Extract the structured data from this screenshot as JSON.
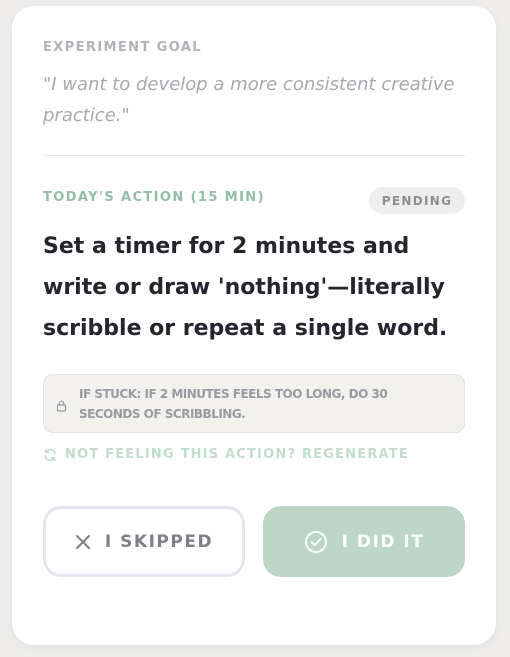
{
  "goal": {
    "label": "EXPERIMENT GOAL",
    "quote": "\"I want to develop a more consistent creative practice.\""
  },
  "action": {
    "label": "TODAY'S ACTION (15 MIN)",
    "status": "PENDING",
    "text": "Set a timer for 2 minutes and write or draw 'nothing'—literally scribble or repeat a single word.",
    "stuck_tip": "IF STUCK: IF 2 MINUTES FEELS TOO LONG, DO 30 SECONDS OF SCRIBBLING.",
    "regenerate": "NOT FEELING THIS ACTION? REGENERATE"
  },
  "buttons": {
    "skip_label": "I SKIPPED",
    "done_label": "I DID IT"
  },
  "icons": {
    "tip": "lock-icon",
    "regenerate": "refresh-icon",
    "skip": "close-icon",
    "done": "check-circle-icon"
  },
  "colors": {
    "accent": "#93bda7",
    "done_button": "#bdd6c6",
    "text_primary": "#25252e"
  }
}
